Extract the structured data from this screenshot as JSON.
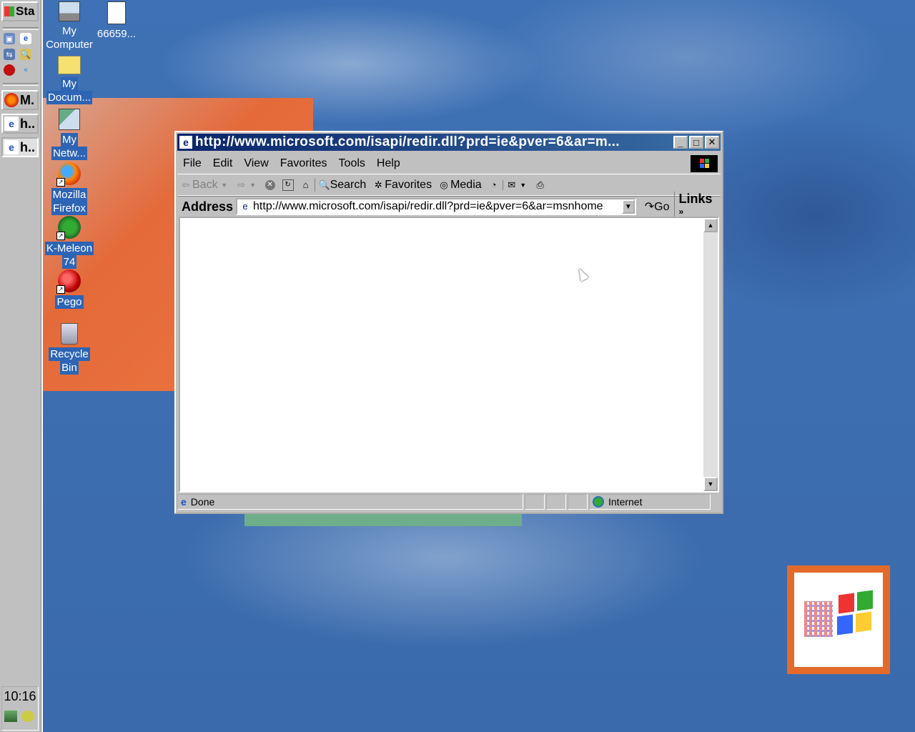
{
  "taskbar": {
    "start_label": "Sta",
    "tasks": [
      {
        "label": "M.",
        "icon": "firefox-icon"
      },
      {
        "label": "h..",
        "icon": "ie-icon"
      },
      {
        "label": "h..",
        "icon": "ie-icon"
      }
    ],
    "clock": "10:16"
  },
  "desktop": {
    "icons": [
      {
        "label_line1": "My",
        "label_line2": "Computer"
      },
      {
        "label_line1": "66659...",
        "label_line2": ""
      },
      {
        "label_line1": "My",
        "label_line2": "Docum..."
      },
      {
        "label_line1": "My",
        "label_line2": "Netw..."
      },
      {
        "label_line1": "Mozilla",
        "label_line2": "Firefox"
      },
      {
        "label_line1": "K-Meleon",
        "label_line2": "74"
      },
      {
        "label_line1": "Pego",
        "label_line2": ""
      },
      {
        "label_line1": "Recycle",
        "label_line2": "Bin"
      }
    ]
  },
  "browser": {
    "title": "http://www.microsoft.com/isapi/redir.dll?prd=ie&pver=6&ar=m...",
    "menu": [
      "File",
      "Edit",
      "View",
      "Favorites",
      "Tools",
      "Help"
    ],
    "toolbar": {
      "back": "Back",
      "search": "Search",
      "favorites": "Favorites",
      "media": "Media"
    },
    "address_label": "Address",
    "address_value": "http://www.microsoft.com/isapi/redir.dll?prd=ie&pver=6&ar=msnhome",
    "go_label": "Go",
    "links_label": "Links",
    "status_text": "Done",
    "zone_text": "Internet"
  },
  "colors": {
    "title_active": "#0a246a",
    "desktop": "#3f6fb0",
    "face": "#c0c0c0"
  }
}
